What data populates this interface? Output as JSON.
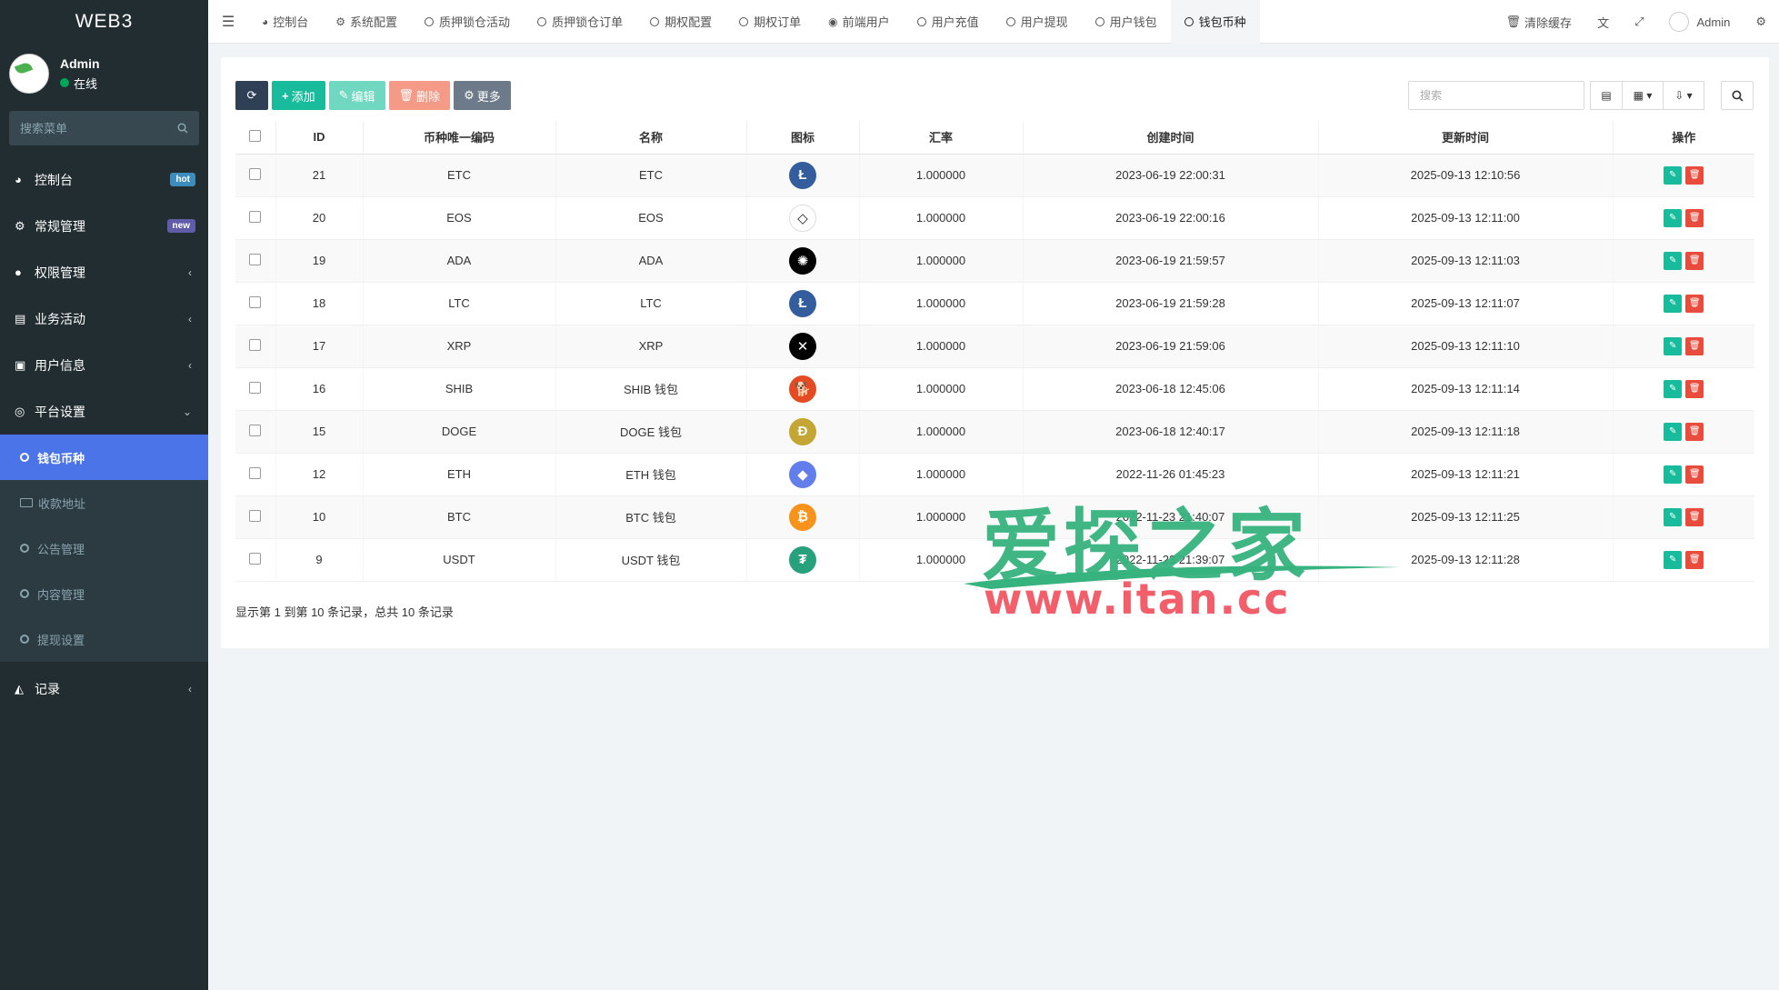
{
  "app": {
    "logo": "WEB3"
  },
  "user": {
    "name": "Admin",
    "status": "在线"
  },
  "sidebar": {
    "search_placeholder": "搜索菜单",
    "items": [
      {
        "label": "控制台",
        "icon": "dashboard-icon",
        "badge": "hot"
      },
      {
        "label": "常规管理",
        "icon": "cogs-icon",
        "badge": "new"
      },
      {
        "label": "权限管理",
        "icon": "group-icon"
      },
      {
        "label": "业务活动",
        "icon": "list-icon"
      },
      {
        "label": "用户信息",
        "icon": "address-book-icon"
      },
      {
        "label": "平台设置",
        "icon": "life-ring-icon"
      }
    ],
    "sub_items": [
      {
        "label": "钱包币种",
        "active": true
      },
      {
        "label": "收款地址"
      },
      {
        "label": "公告管理"
      },
      {
        "label": "内容管理"
      },
      {
        "label": "提现设置"
      }
    ],
    "records": {
      "label": "记录",
      "icon": "area-chart-icon"
    }
  },
  "topnav": {
    "tabs": [
      {
        "label": "控制台"
      },
      {
        "label": "系统配置"
      },
      {
        "label": "质押锁仓活动"
      },
      {
        "label": "质押锁仓订单"
      },
      {
        "label": "期权配置"
      },
      {
        "label": "期权订单"
      },
      {
        "label": "前端用户"
      },
      {
        "label": "用户充值"
      },
      {
        "label": "用户提现"
      },
      {
        "label": "用户钱包"
      },
      {
        "label": "钱包币种"
      }
    ],
    "clear_cache": "清除缓存",
    "admin": "Admin"
  },
  "toolbar": {
    "add": "添加",
    "edit": "编辑",
    "delete": "删除",
    "more": "更多",
    "search_placeholder": "搜索"
  },
  "table": {
    "columns": [
      "ID",
      "币种唯一编码",
      "名称",
      "图标",
      "汇率",
      "创建时间",
      "更新时间",
      "操作"
    ],
    "rows": [
      {
        "id": "21",
        "code": "ETC",
        "name": "ETC",
        "icon": "ltc-icon",
        "color": "#345d9d",
        "rate": "1.000000",
        "created": "2023-06-19 22:00:31",
        "updated": "2025-09-13 12:10:56"
      },
      {
        "id": "20",
        "code": "EOS",
        "name": "EOS",
        "icon": "eos-icon",
        "color": "#ffffff",
        "rate": "1.000000",
        "created": "2023-06-19 22:00:16",
        "updated": "2025-09-13 12:11:00"
      },
      {
        "id": "19",
        "code": "ADA",
        "name": "ADA",
        "icon": "ada-icon",
        "color": "#000000",
        "rate": "1.000000",
        "created": "2023-06-19 21:59:57",
        "updated": "2025-09-13 12:11:03"
      },
      {
        "id": "18",
        "code": "LTC",
        "name": "LTC",
        "icon": "ltc-icon",
        "color": "#345d9d",
        "rate": "1.000000",
        "created": "2023-06-19 21:59:28",
        "updated": "2025-09-13 12:11:07"
      },
      {
        "id": "17",
        "code": "XRP",
        "name": "XRP",
        "icon": "xrp-icon",
        "color": "#000000",
        "rate": "1.000000",
        "created": "2023-06-19 21:59:06",
        "updated": "2025-09-13 12:11:10"
      },
      {
        "id": "16",
        "code": "SHIB",
        "name": "SHIB 钱包",
        "icon": "shib-icon",
        "color": "#e44b23",
        "rate": "1.000000",
        "created": "2023-06-18 12:45:06",
        "updated": "2025-09-13 12:11:14"
      },
      {
        "id": "15",
        "code": "DOGE",
        "name": "DOGE 钱包",
        "icon": "doge-icon",
        "color": "#c3a634",
        "rate": "1.000000",
        "created": "2023-06-18 12:40:17",
        "updated": "2025-09-13 12:11:18"
      },
      {
        "id": "12",
        "code": "ETH",
        "name": "ETH 钱包",
        "icon": "eth-icon",
        "color": "#627eea",
        "rate": "1.000000",
        "created": "2022-11-26 01:45:23",
        "updated": "2025-09-13 12:11:21"
      },
      {
        "id": "10",
        "code": "BTC",
        "name": "BTC 钱包",
        "icon": "btc-icon",
        "color": "#f7931a",
        "rate": "1.000000",
        "created": "2022-11-23 21:40:07",
        "updated": "2025-09-13 12:11:25"
      },
      {
        "id": "9",
        "code": "USDT",
        "name": "USDT 钱包",
        "icon": "usdt-icon",
        "color": "#26a17b",
        "rate": "1.000000",
        "created": "2022-11-23 21:39:07",
        "updated": "2025-09-13 12:11:28"
      }
    ]
  },
  "footer": {
    "summary": "显示第 1 到第 10 条记录，总共 10 条记录"
  },
  "watermark": {
    "title": "爱探之家",
    "url": "www.itan.cc"
  }
}
